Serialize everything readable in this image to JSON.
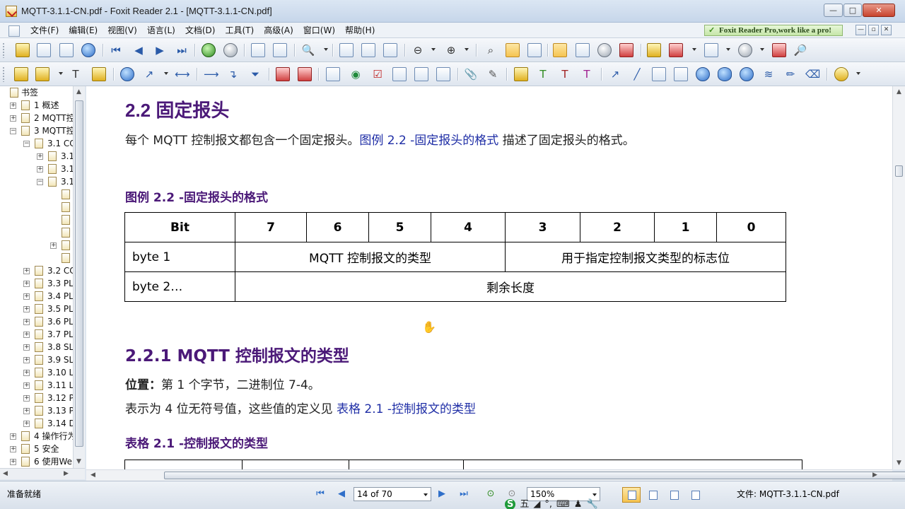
{
  "window": {
    "title": "MQTT-3.1.1-CN.pdf - Foxit Reader 2.1 - [MQTT-3.1.1-CN.pdf]",
    "min_label": "—",
    "max_label": "□",
    "close_label": "✕"
  },
  "menu": {
    "items": [
      "文件(F)",
      "编辑(E)",
      "视图(V)",
      "语言(L)",
      "文档(D)",
      "工具(T)",
      "高级(A)",
      "窗口(W)",
      "帮助(H)"
    ],
    "promo": "Foxit Reader Pro,work like a pro!"
  },
  "bookmarks": {
    "header": "书签",
    "items": [
      {
        "label": "1 概述"
      },
      {
        "label": "2 MQTT控"
      },
      {
        "label": "3 MQTT控"
      },
      {
        "label": "3.1 CC"
      },
      {
        "label": "3.1"
      },
      {
        "label": "3.1"
      },
      {
        "label": "3.1"
      },
      {
        "label": ""
      },
      {
        "label": ""
      },
      {
        "label": ""
      },
      {
        "label": ""
      },
      {
        "label": ""
      },
      {
        "label": "3.1"
      },
      {
        "label": "3.2 CC"
      },
      {
        "label": "3.3 PL"
      },
      {
        "label": "3.4 PL"
      },
      {
        "label": "3.5 PL"
      },
      {
        "label": "3.6 PL"
      },
      {
        "label": "3.7 PL"
      },
      {
        "label": "3.8 SL"
      },
      {
        "label": "3.9 SL"
      },
      {
        "label": "3.10 L"
      },
      {
        "label": "3.11 L"
      },
      {
        "label": "3.12 P"
      },
      {
        "label": "3.13 P"
      },
      {
        "label": "3.14 D"
      },
      {
        "label": "4 操作行为"
      },
      {
        "label": "5 安全"
      },
      {
        "label": "6 使用We"
      }
    ]
  },
  "document": {
    "section_title": "2.2 固定报头",
    "intro_text": "每个 MQTT 控制报文都包含一个固定报头。",
    "intro_link": "图例 2.2 -固定报头的格式",
    "intro_tail": " 描述了固定报头的格式。",
    "figure_caption": "图例 2.2 -固定报头的格式",
    "fixed_header_table": {
      "header": [
        "Bit",
        "7",
        "6",
        "5",
        "4",
        "3",
        "2",
        "1",
        "0"
      ],
      "row1_label": "byte 1",
      "row1_high": "MQTT 控制报文的类型",
      "row1_low": "用于指定控制报文类型的标志位",
      "row2_label": "byte 2…",
      "row2_value": "剩余长度"
    },
    "subsection_title": "2.2.1 MQTT 控制报文的类型",
    "position_label": "位置：",
    "position_text": "第 1 个字节，二进制位 7-4。",
    "desc_text": "表示为 4 位无符号值，这些值的定义见 ",
    "desc_link": "表格 2.1 -控制报文的类型",
    "table_caption": "表格 2.1 -控制报文的类型"
  },
  "status": {
    "ready": "准备就绪",
    "page": "14 of 70",
    "zoom": "150%",
    "file": "文件: MQTT-3.1.1-CN.pdf",
    "ime": [
      "S",
      "五",
      "◢",
      "°,",
      "⌨",
      "♟",
      "🔧"
    ]
  },
  "colors": {
    "heading": "#4b1978",
    "link": "#1f2ea6",
    "toolbar_bg": "#dfe6ef"
  }
}
